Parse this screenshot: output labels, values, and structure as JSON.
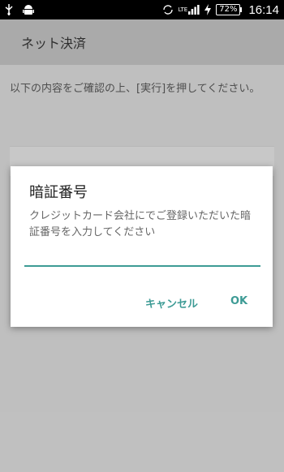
{
  "status_bar": {
    "time": "16:14",
    "battery": "72%",
    "network": "LTE",
    "icons": [
      "usb-icon",
      "android-icon",
      "sync-icon",
      "signal-icon",
      "charging-icon",
      "battery-icon"
    ]
  },
  "app_bar": {
    "title": "ネット決済"
  },
  "main": {
    "instruction": "以下の内容をご確認の上、[実行]を押してください。"
  },
  "dialog": {
    "title": "暗証番号",
    "message": "クレジットカード会社にでご登録いただいた暗証番号を入力してください",
    "input_value": "",
    "cancel_label": "キャンセル",
    "ok_label": "OK"
  },
  "colors": {
    "accent": "#3d9b95",
    "status_bar": "#000000",
    "app_bar": "#b9b9b9"
  }
}
